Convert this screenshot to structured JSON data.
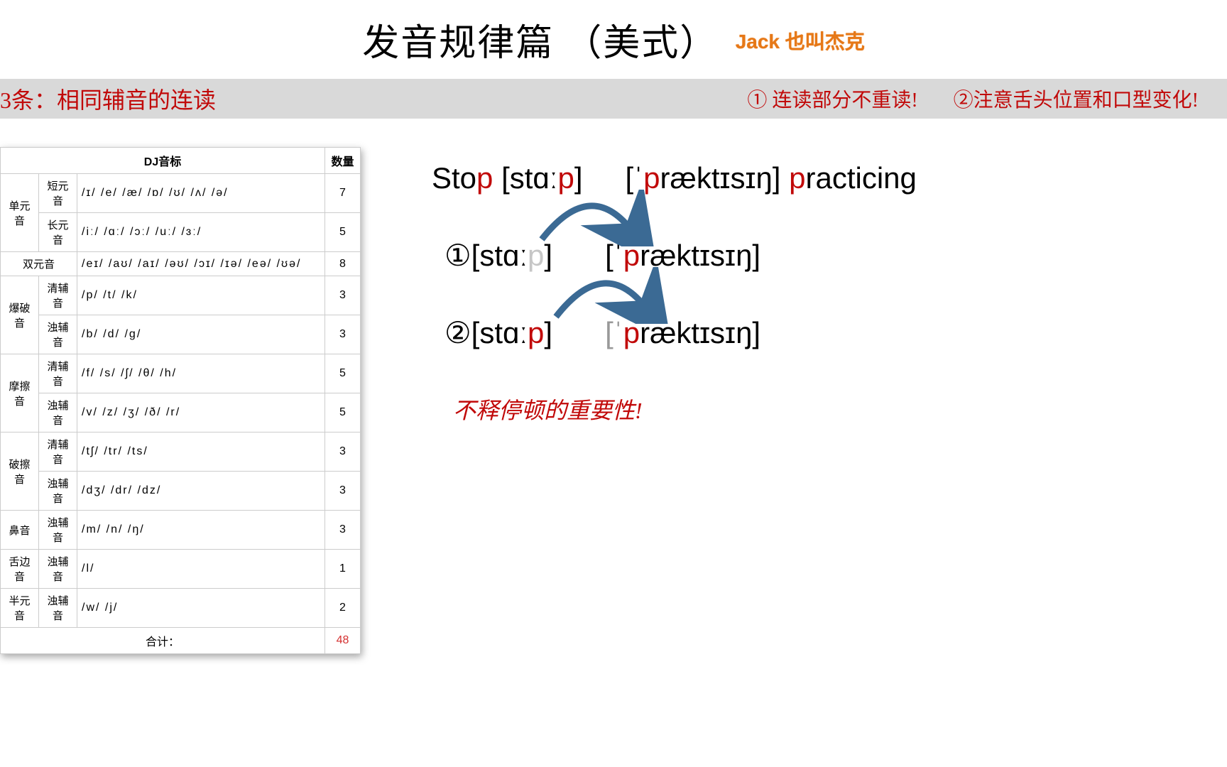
{
  "header": {
    "title": "发音规律篇 （美式）",
    "author": "Jack 也叫杰克"
  },
  "bar": {
    "left": "3条：相同辅音的连读",
    "tip1": "① 连读部分不重读!",
    "tip2": "②注意舌头位置和口型变化!"
  },
  "table": {
    "title": "DJ音标",
    "count_header": "数量",
    "total_label": "合计：",
    "total_value": "48",
    "rows": [
      {
        "cat": "单元音",
        "sub": "短元音",
        "symbols": "/ɪ/  /e/  /æ/  /ɒ/  /ʊ/  /ʌ/  /ə/",
        "count": "7"
      },
      {
        "cat": "",
        "sub": "长元音",
        "symbols": "/iː/  /ɑː/  /ɔː/  /uː/  /ɜː/",
        "count": "5"
      },
      {
        "cat": "双元音",
        "sub": "",
        "symbols": "/eɪ/  /aʊ/  /aɪ/  /əʊ/  /ɔɪ/  /ɪə/  /eə/  /ʊə/",
        "count": "8"
      },
      {
        "cat": "爆破音",
        "sub": "清辅音",
        "symbols": "/p/  /t/  /k/",
        "count": "3"
      },
      {
        "cat": "",
        "sub": "浊辅音",
        "symbols": "/b/  /d/  /g/",
        "count": "3"
      },
      {
        "cat": "摩擦音",
        "sub": "清辅音",
        "symbols": "/f/  /s/  /ʃ/  /θ/  /h/",
        "count": "5"
      },
      {
        "cat": "",
        "sub": "浊辅音",
        "symbols": "/v/  /z/  /ʒ/  /ð/  /r/",
        "count": "5"
      },
      {
        "cat": "破擦音",
        "sub": "清辅音",
        "symbols": "/tʃ/  /tr/  /ts/",
        "count": "3"
      },
      {
        "cat": "",
        "sub": "浊辅音",
        "symbols": "/dʒ/  /dr/  /dz/",
        "count": "3"
      },
      {
        "cat": "鼻音",
        "sub": "浊辅音",
        "symbols": "/m/  /n/  /ŋ/",
        "count": "3"
      },
      {
        "cat": "舌边音",
        "sub": "浊辅音",
        "symbols": "/l/",
        "count": "1"
      },
      {
        "cat": "半元音",
        "sub": "浊辅音",
        "symbols": "/w/  /j/",
        "count": "2"
      }
    ]
  },
  "example": {
    "line0_p1": "Sto",
    "line0_p2": "p",
    "line0_p3": " [stɑː",
    "line0_p4": "p",
    "line0_p5": "]",
    "line0_p6": "[ˈ",
    "line0_p7": "p",
    "line0_p8": "ræktɪsɪŋ] ",
    "line0_p9": "p",
    "line0_p10": "racticing",
    "m1": "①",
    "m2": "②",
    "l1_a": "[stɑː",
    "l1_b": "p",
    "l1_c": "]",
    "l1_d": "[ˈ",
    "l1_e": "p",
    "l1_f": "ræktɪsɪŋ]",
    "l2_a": "[stɑː",
    "l2_b": "p",
    "l2_c": "]",
    "l2_d": "[ˈ",
    "l2_e": "p",
    "l2_f": "ræktɪsɪŋ]"
  },
  "note": "不释停顿的重要性!"
}
